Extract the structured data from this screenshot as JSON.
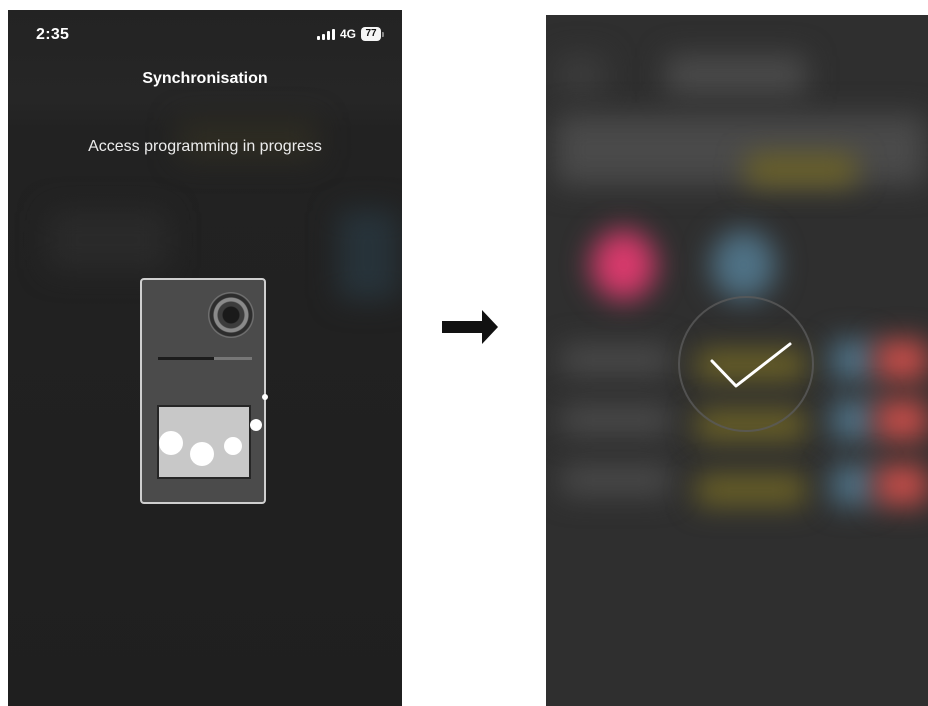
{
  "left_screen": {
    "status_bar": {
      "time": "2:35",
      "network": "4G",
      "battery": "77",
      "icons": [
        "signal-bars-icon",
        "battery-icon"
      ]
    },
    "title": "Synchronisation",
    "message": "Access programming in progress",
    "illustration": {
      "name": "door-entry-panel",
      "progress": 0.6
    }
  },
  "transition_icon": "right-arrow-icon",
  "right_screen": {
    "state": "blurred-background",
    "overlay_icon": "checkmark-icon"
  },
  "colors": {
    "screen_bg": "#222222",
    "blurred_bg": "#2f2f2f",
    "device_body": "#4b4b4b",
    "device_panel": "#c8c8c8",
    "ghost_pink": "#d83a6c",
    "ghost_blue": "#4f7286",
    "ghost_yellow": "#6d6326",
    "ghost_red": "#c84e4a"
  }
}
